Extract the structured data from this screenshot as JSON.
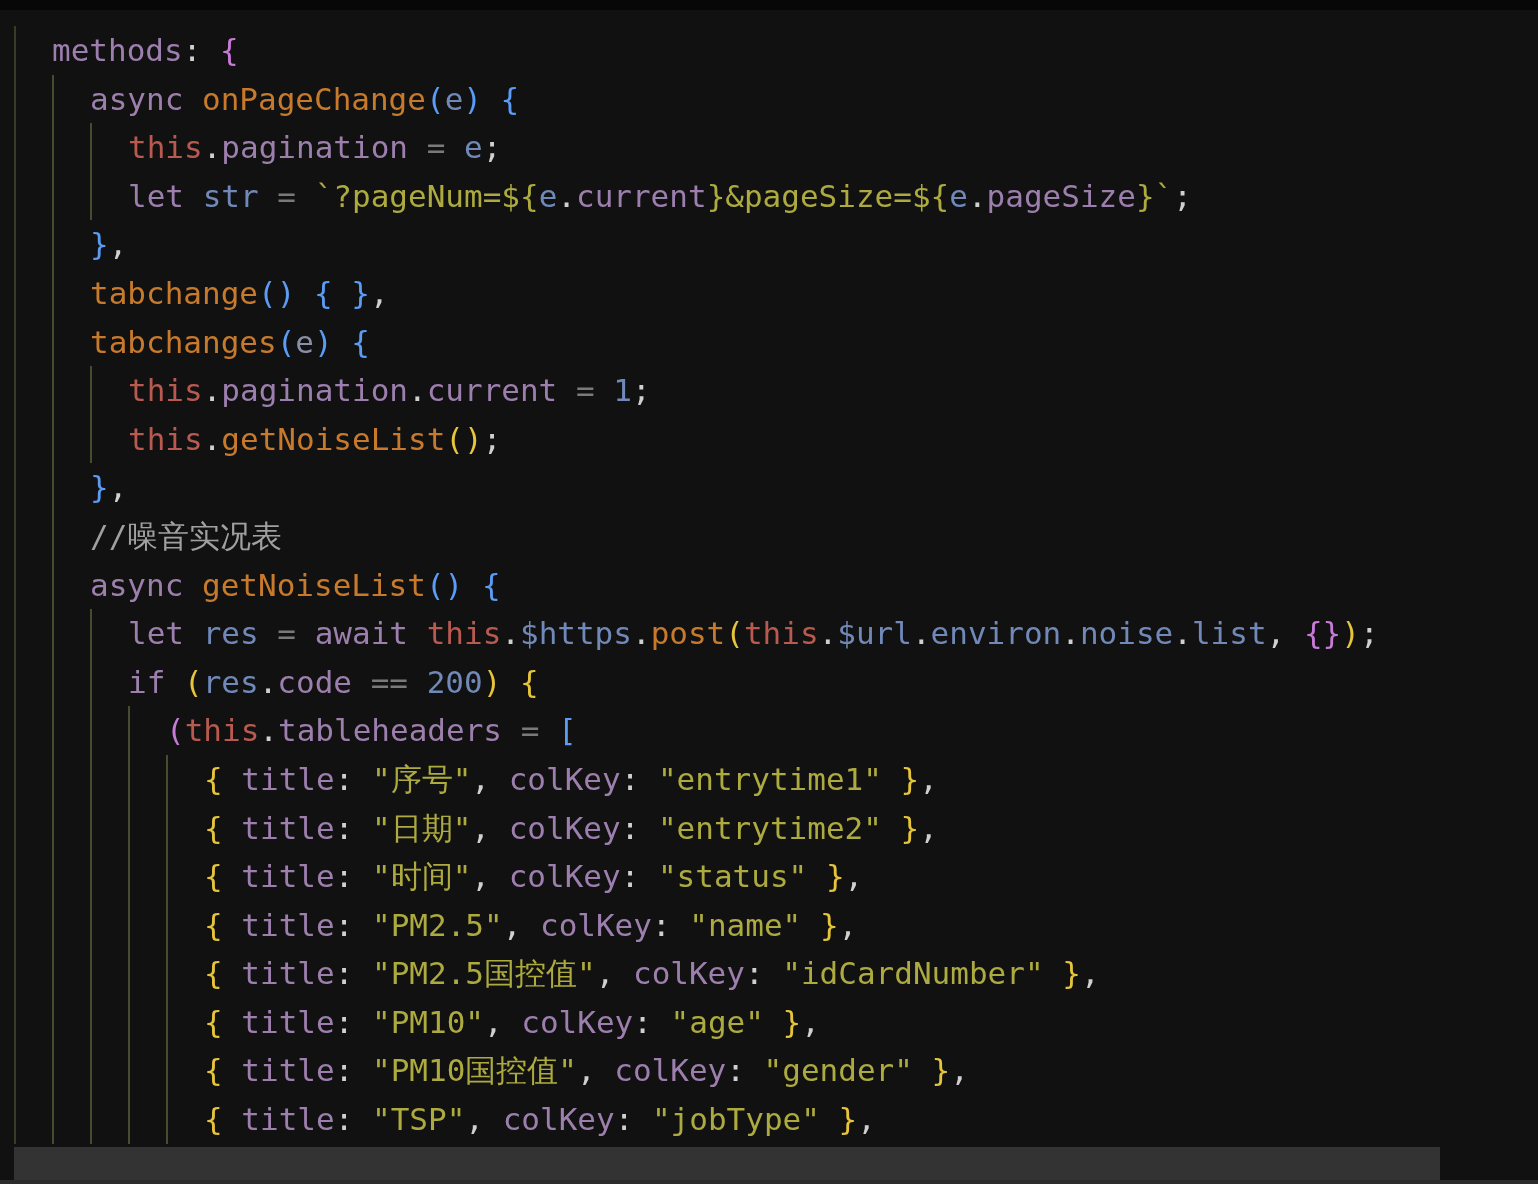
{
  "editor": {
    "lines": [
      {
        "tokens": [
          {
            "kind": "prop",
            "text": "methods"
          },
          {
            "kind": "punct",
            "text": ": "
          },
          {
            "kind": "b2",
            "text": "{"
          }
        ],
        "children": [
          {
            "tokens": [
              {
                "kind": "kw",
                "text": "async "
              },
              {
                "kind": "fn",
                "text": "onPageChange"
              },
              {
                "kind": "b3",
                "text": "("
              },
              {
                "kind": "var",
                "text": "e"
              },
              {
                "kind": "b3",
                "text": ") {"
              }
            ],
            "children": [
              {
                "tokens": [
                  {
                    "kind": "this",
                    "text": "this"
                  },
                  {
                    "kind": "punct",
                    "text": "."
                  },
                  {
                    "kind": "prop",
                    "text": "pagination"
                  },
                  {
                    "kind": "op",
                    "text": " = "
                  },
                  {
                    "kind": "var",
                    "text": "e"
                  },
                  {
                    "kind": "punct",
                    "text": ";"
                  }
                ]
              },
              {
                "tokens": [
                  {
                    "kind": "kw",
                    "text": "let "
                  },
                  {
                    "kind": "var",
                    "text": "str"
                  },
                  {
                    "kind": "op",
                    "text": " = "
                  },
                  {
                    "kind": "str",
                    "text": "`?pageNum=${"
                  },
                  {
                    "kind": "var",
                    "text": "e"
                  },
                  {
                    "kind": "punct",
                    "text": "."
                  },
                  {
                    "kind": "prop",
                    "text": "current"
                  },
                  {
                    "kind": "str",
                    "text": "}&pageSize=${"
                  },
                  {
                    "kind": "var",
                    "text": "e"
                  },
                  {
                    "kind": "punct",
                    "text": "."
                  },
                  {
                    "kind": "prop",
                    "text": "pageSize"
                  },
                  {
                    "kind": "str",
                    "text": "}`"
                  },
                  {
                    "kind": "punct",
                    "text": ";"
                  }
                ]
              }
            ]
          },
          {
            "tokens": [
              {
                "kind": "b3",
                "text": "}"
              },
              {
                "kind": "punct",
                "text": ","
              }
            ]
          },
          {
            "tokens": [
              {
                "kind": "fn",
                "text": "tabchange"
              },
              {
                "kind": "b3",
                "text": "() { }"
              },
              {
                "kind": "punct",
                "text": ","
              }
            ]
          },
          {
            "tokens": [
              {
                "kind": "fn",
                "text": "tabchanges"
              },
              {
                "kind": "b3",
                "text": "("
              },
              {
                "kind": "param",
                "text": "e"
              },
              {
                "kind": "b3",
                "text": ") {"
              }
            ],
            "children": [
              {
                "tokens": [
                  {
                    "kind": "this",
                    "text": "this"
                  },
                  {
                    "kind": "punct",
                    "text": "."
                  },
                  {
                    "kind": "prop",
                    "text": "pagination"
                  },
                  {
                    "kind": "punct",
                    "text": "."
                  },
                  {
                    "kind": "prop",
                    "text": "current"
                  },
                  {
                    "kind": "op",
                    "text": " = "
                  },
                  {
                    "kind": "num",
                    "text": "1"
                  },
                  {
                    "kind": "punct",
                    "text": ";"
                  }
                ]
              },
              {
                "tokens": [
                  {
                    "kind": "this",
                    "text": "this"
                  },
                  {
                    "kind": "punct",
                    "text": "."
                  },
                  {
                    "kind": "fn",
                    "text": "getNoiseList"
                  },
                  {
                    "kind": "b1",
                    "text": "()"
                  },
                  {
                    "kind": "punct",
                    "text": ";"
                  }
                ]
              }
            ]
          },
          {
            "tokens": [
              {
                "kind": "b3",
                "text": "}"
              },
              {
                "kind": "punct",
                "text": ","
              }
            ]
          },
          {
            "tokens": [
              {
                "kind": "comment",
                "text": "//噪音实况表"
              }
            ]
          },
          {
            "tokens": [
              {
                "kind": "kw",
                "text": "async "
              },
              {
                "kind": "fn",
                "text": "getNoiseList"
              },
              {
                "kind": "b3",
                "text": "() {"
              }
            ],
            "children": [
              {
                "tokens": [
                  {
                    "kind": "kw",
                    "text": "let "
                  },
                  {
                    "kind": "var",
                    "text": "res"
                  },
                  {
                    "kind": "op",
                    "text": " = "
                  },
                  {
                    "kind": "kw",
                    "text": "await "
                  },
                  {
                    "kind": "this",
                    "text": "this"
                  },
                  {
                    "kind": "punct",
                    "text": "."
                  },
                  {
                    "kind": "var",
                    "text": "$https"
                  },
                  {
                    "kind": "punct",
                    "text": "."
                  },
                  {
                    "kind": "fn",
                    "text": "post"
                  },
                  {
                    "kind": "b1",
                    "text": "("
                  },
                  {
                    "kind": "this",
                    "text": "this"
                  },
                  {
                    "kind": "punct",
                    "text": "."
                  },
                  {
                    "kind": "var",
                    "text": "$url"
                  },
                  {
                    "kind": "punct",
                    "text": "."
                  },
                  {
                    "kind": "var",
                    "text": "environ"
                  },
                  {
                    "kind": "punct",
                    "text": "."
                  },
                  {
                    "kind": "var",
                    "text": "noise"
                  },
                  {
                    "kind": "punct",
                    "text": "."
                  },
                  {
                    "kind": "var",
                    "text": "list"
                  },
                  {
                    "kind": "punct",
                    "text": ", "
                  },
                  {
                    "kind": "b2",
                    "text": "{}"
                  },
                  {
                    "kind": "b1",
                    "text": ")"
                  },
                  {
                    "kind": "punct",
                    "text": ";"
                  }
                ]
              },
              {
                "tokens": [
                  {
                    "kind": "kw",
                    "text": "if "
                  },
                  {
                    "kind": "b1",
                    "text": "("
                  },
                  {
                    "kind": "var",
                    "text": "res"
                  },
                  {
                    "kind": "punct",
                    "text": "."
                  },
                  {
                    "kind": "prop",
                    "text": "code"
                  },
                  {
                    "kind": "op",
                    "text": " == "
                  },
                  {
                    "kind": "num",
                    "text": "200"
                  },
                  {
                    "kind": "b1",
                    "text": ") {"
                  }
                ],
                "children": [
                  {
                    "tokens": [
                      {
                        "kind": "b2",
                        "text": "("
                      },
                      {
                        "kind": "this",
                        "text": "this"
                      },
                      {
                        "kind": "punct",
                        "text": "."
                      },
                      {
                        "kind": "prop",
                        "text": "tableheaders"
                      },
                      {
                        "kind": "op",
                        "text": " = "
                      },
                      {
                        "kind": "b3",
                        "text": "["
                      }
                    ],
                    "children": [
                      {
                        "tokens": [
                          {
                            "kind": "b1",
                            "text": "{ "
                          },
                          {
                            "kind": "prop",
                            "text": "title"
                          },
                          {
                            "kind": "punct",
                            "text": ": "
                          },
                          {
                            "kind": "str",
                            "text": "\"序号\""
                          },
                          {
                            "kind": "punct",
                            "text": ", "
                          },
                          {
                            "kind": "prop",
                            "text": "colKey"
                          },
                          {
                            "kind": "punct",
                            "text": ": "
                          },
                          {
                            "kind": "str",
                            "text": "\"entrytime1\""
                          },
                          {
                            "kind": "b1",
                            "text": " }"
                          },
                          {
                            "kind": "punct",
                            "text": ","
                          }
                        ]
                      },
                      {
                        "tokens": [
                          {
                            "kind": "b1",
                            "text": "{ "
                          },
                          {
                            "kind": "prop",
                            "text": "title"
                          },
                          {
                            "kind": "punct",
                            "text": ": "
                          },
                          {
                            "kind": "str",
                            "text": "\"日期\""
                          },
                          {
                            "kind": "punct",
                            "text": ", "
                          },
                          {
                            "kind": "prop",
                            "text": "colKey"
                          },
                          {
                            "kind": "punct",
                            "text": ": "
                          },
                          {
                            "kind": "str",
                            "text": "\"entrytime2\""
                          },
                          {
                            "kind": "b1",
                            "text": " }"
                          },
                          {
                            "kind": "punct",
                            "text": ","
                          }
                        ]
                      },
                      {
                        "tokens": [
                          {
                            "kind": "b1",
                            "text": "{ "
                          },
                          {
                            "kind": "prop",
                            "text": "title"
                          },
                          {
                            "kind": "punct",
                            "text": ": "
                          },
                          {
                            "kind": "str",
                            "text": "\"时间\""
                          },
                          {
                            "kind": "punct",
                            "text": ", "
                          },
                          {
                            "kind": "prop",
                            "text": "colKey"
                          },
                          {
                            "kind": "punct",
                            "text": ": "
                          },
                          {
                            "kind": "str",
                            "text": "\"status\""
                          },
                          {
                            "kind": "b1",
                            "text": " }"
                          },
                          {
                            "kind": "punct",
                            "text": ","
                          }
                        ]
                      },
                      {
                        "tokens": [
                          {
                            "kind": "b1",
                            "text": "{ "
                          },
                          {
                            "kind": "prop",
                            "text": "title"
                          },
                          {
                            "kind": "punct",
                            "text": ": "
                          },
                          {
                            "kind": "str",
                            "text": "\"PM2.5\""
                          },
                          {
                            "kind": "punct",
                            "text": ", "
                          },
                          {
                            "kind": "prop",
                            "text": "colKey"
                          },
                          {
                            "kind": "punct",
                            "text": ": "
                          },
                          {
                            "kind": "str",
                            "text": "\"name\""
                          },
                          {
                            "kind": "b1",
                            "text": " }"
                          },
                          {
                            "kind": "punct",
                            "text": ","
                          }
                        ]
                      },
                      {
                        "tokens": [
                          {
                            "kind": "b1",
                            "text": "{ "
                          },
                          {
                            "kind": "prop",
                            "text": "title"
                          },
                          {
                            "kind": "punct",
                            "text": ": "
                          },
                          {
                            "kind": "str",
                            "text": "\"PM2.5国控值\""
                          },
                          {
                            "kind": "punct",
                            "text": ", "
                          },
                          {
                            "kind": "prop",
                            "text": "colKey"
                          },
                          {
                            "kind": "punct",
                            "text": ": "
                          },
                          {
                            "kind": "str",
                            "text": "\"idCardNumber\""
                          },
                          {
                            "kind": "b1",
                            "text": " }"
                          },
                          {
                            "kind": "punct",
                            "text": ","
                          }
                        ]
                      },
                      {
                        "tokens": [
                          {
                            "kind": "b1",
                            "text": "{ "
                          },
                          {
                            "kind": "prop",
                            "text": "title"
                          },
                          {
                            "kind": "punct",
                            "text": ": "
                          },
                          {
                            "kind": "str",
                            "text": "\"PM10\""
                          },
                          {
                            "kind": "punct",
                            "text": ", "
                          },
                          {
                            "kind": "prop",
                            "text": "colKey"
                          },
                          {
                            "kind": "punct",
                            "text": ": "
                          },
                          {
                            "kind": "str",
                            "text": "\"age\""
                          },
                          {
                            "kind": "b1",
                            "text": " }"
                          },
                          {
                            "kind": "punct",
                            "text": ","
                          }
                        ]
                      },
                      {
                        "tokens": [
                          {
                            "kind": "b1",
                            "text": "{ "
                          },
                          {
                            "kind": "prop",
                            "text": "title"
                          },
                          {
                            "kind": "punct",
                            "text": ": "
                          },
                          {
                            "kind": "str",
                            "text": "\"PM10国控值\""
                          },
                          {
                            "kind": "punct",
                            "text": ", "
                          },
                          {
                            "kind": "prop",
                            "text": "colKey"
                          },
                          {
                            "kind": "punct",
                            "text": ": "
                          },
                          {
                            "kind": "str",
                            "text": "\"gender\""
                          },
                          {
                            "kind": "b1",
                            "text": " }"
                          },
                          {
                            "kind": "punct",
                            "text": ","
                          }
                        ]
                      },
                      {
                        "tokens": [
                          {
                            "kind": "b1",
                            "text": "{ "
                          },
                          {
                            "kind": "prop",
                            "text": "title"
                          },
                          {
                            "kind": "punct",
                            "text": ": "
                          },
                          {
                            "kind": "str",
                            "text": "\"TSP\""
                          },
                          {
                            "kind": "punct",
                            "text": ", "
                          },
                          {
                            "kind": "prop",
                            "text": "colKey"
                          },
                          {
                            "kind": "punct",
                            "text": ": "
                          },
                          {
                            "kind": "str",
                            "text": "\"jobType\""
                          },
                          {
                            "kind": "b1",
                            "text": " }"
                          },
                          {
                            "kind": "punct",
                            "text": ","
                          }
                        ]
                      }
                    ]
                  }
                ]
              }
            ]
          }
        ]
      }
    ]
  }
}
